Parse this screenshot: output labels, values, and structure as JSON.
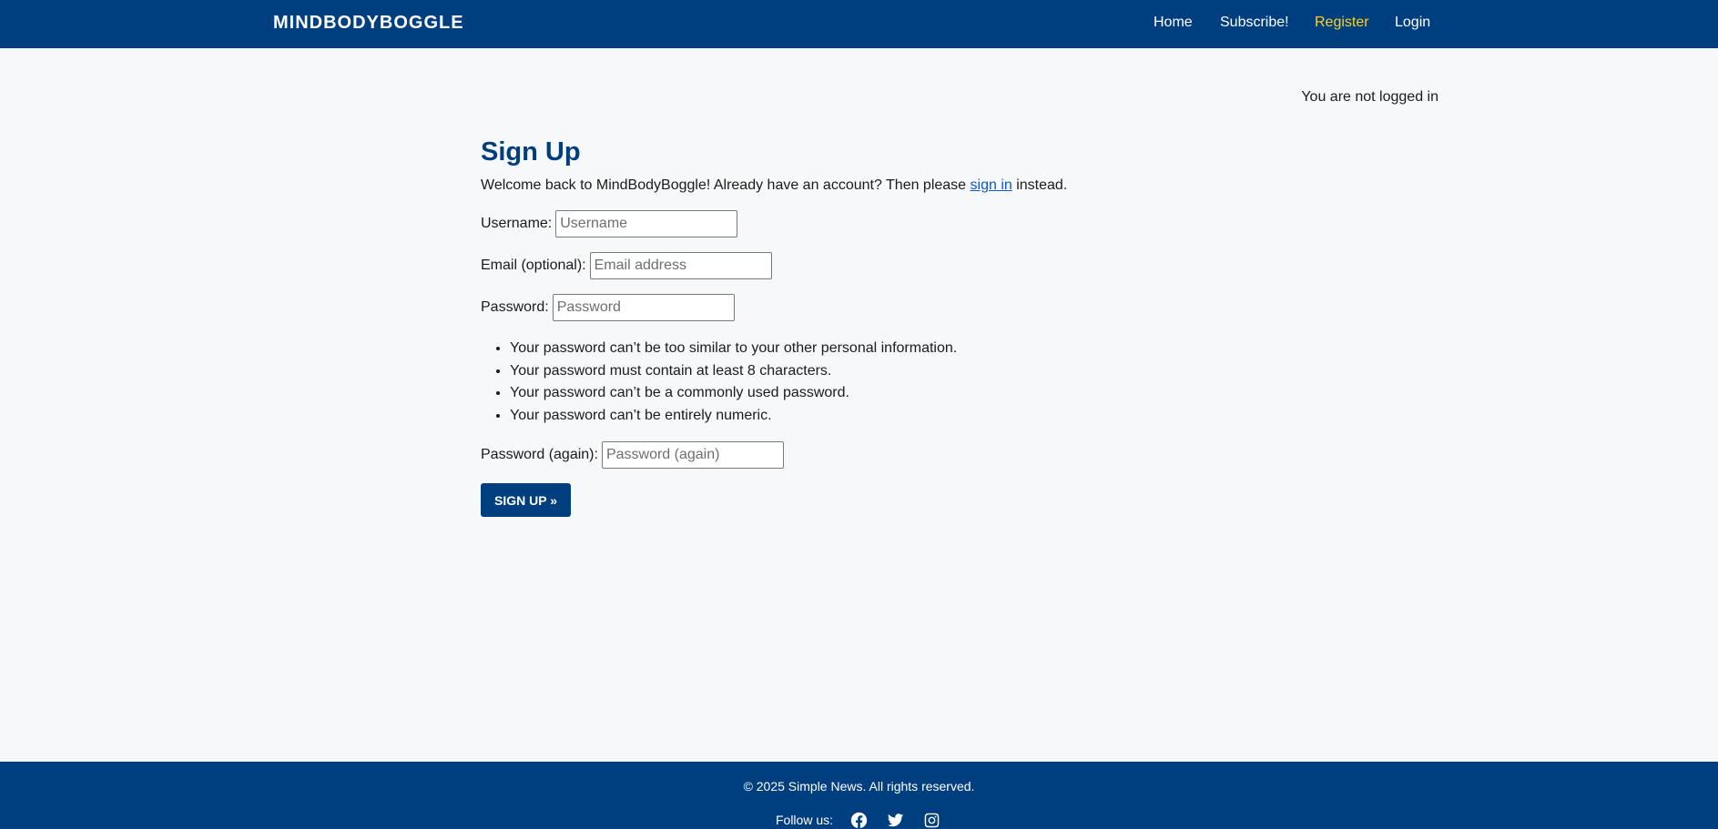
{
  "header": {
    "brand": "MINDBODYBOGGLE",
    "nav": [
      {
        "label": "Home",
        "active": false
      },
      {
        "label": "Subscribe!",
        "active": false
      },
      {
        "label": "Register",
        "active": true
      },
      {
        "label": "Login",
        "active": false
      }
    ],
    "active_color": "#ffd21f",
    "background": "#003f7f"
  },
  "status": {
    "login_text": "You are not logged in"
  },
  "main": {
    "title": "Sign Up",
    "intro_before": "Welcome back to MindBodyBoggle! Already have an account? Then please ",
    "intro_link": "sign in",
    "intro_after": " instead.",
    "fields": {
      "username": {
        "label": "Username:",
        "placeholder": "Username",
        "value": ""
      },
      "email": {
        "label": "Email (optional):",
        "placeholder": "Email address",
        "value": ""
      },
      "password": {
        "label": "Password:",
        "placeholder": "Password",
        "value": ""
      },
      "password_again": {
        "label": "Password (again):",
        "placeholder": "Password (again)",
        "value": ""
      }
    },
    "password_help": [
      "Your password can’t be too similar to your other personal information.",
      "Your password must contain at least 8 characters.",
      "Your password can’t be a commonly used password.",
      "Your password can’t be entirely numeric."
    ],
    "submit_label": "SIGN UP »"
  },
  "footer": {
    "copyright": "© 2025 Simple News. All rights reserved.",
    "follow_label": "Follow us:",
    "social_icons": [
      "facebook-icon",
      "twitter-icon",
      "instagram-icon"
    ]
  }
}
